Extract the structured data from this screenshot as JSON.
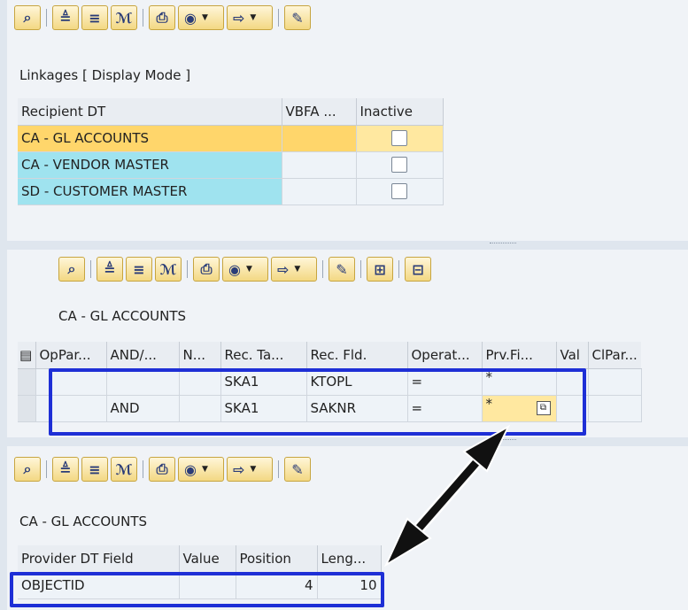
{
  "top_pane": {
    "title": "Linkages [ Display Mode ]",
    "columns": [
      "Recipient DT",
      "VBFA ...",
      "Inactive"
    ],
    "rows": [
      {
        "recipient": "CA - GL ACCOUNTS",
        "vbfa": "",
        "inactive": false,
        "selected": true
      },
      {
        "recipient": "CA - VENDOR MASTER",
        "vbfa": "",
        "inactive": false,
        "selected": false
      },
      {
        "recipient": "SD - CUSTOMER MASTER",
        "vbfa": "",
        "inactive": false,
        "selected": false
      }
    ]
  },
  "middle_pane": {
    "title": "CA - GL ACCOUNTS",
    "columns": [
      "OpPar...",
      "AND/...",
      "N...",
      "Rec. Ta...",
      "Rec. Fld.",
      "Operat...",
      "Prv.Fi...",
      "Val",
      "ClPar..."
    ],
    "rows": [
      {
        "oppar": "",
        "andor": "",
        "n": "",
        "rec_table": "SKA1",
        "rec_field": "KTOPL",
        "operator": "=",
        "prv_field": "*",
        "val": "",
        "clpar": ""
      },
      {
        "oppar": "",
        "andor": "AND",
        "n": "",
        "rec_table": "SKA1",
        "rec_field": "SAKNR",
        "operator": "=",
        "prv_field": "*",
        "val": "",
        "clpar": ""
      }
    ]
  },
  "bottom_pane": {
    "title": "CA - GL ACCOUNTS",
    "columns": [
      "Provider DT Field",
      "Value",
      "Position",
      "Leng..."
    ],
    "rows": [
      {
        "field": "OBJECTID",
        "value": "",
        "position": "4",
        "length": "10"
      }
    ]
  },
  "colors": {
    "highlight": "#1e2fd6",
    "selected_row": "#ffd66b",
    "key_column": "#9fe3ef"
  }
}
